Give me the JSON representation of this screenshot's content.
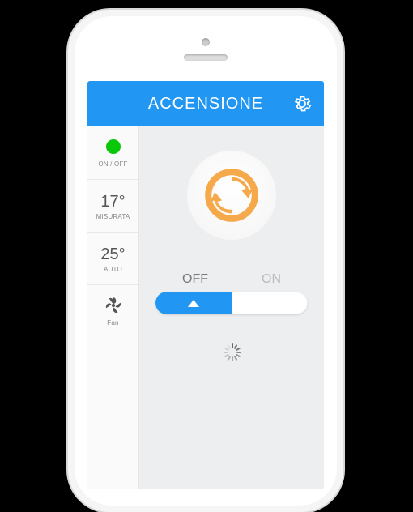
{
  "header": {
    "title": "ACCENSIONE"
  },
  "sidebar": {
    "onoff_label": "ON / OFF",
    "measured": {
      "value": "17°",
      "label": "MISURATA"
    },
    "auto": {
      "value": "25°",
      "label": "AUTO"
    },
    "fan": {
      "label": "Fan"
    }
  },
  "toggle": {
    "off": "OFF",
    "on": "ON",
    "state": "off"
  }
}
